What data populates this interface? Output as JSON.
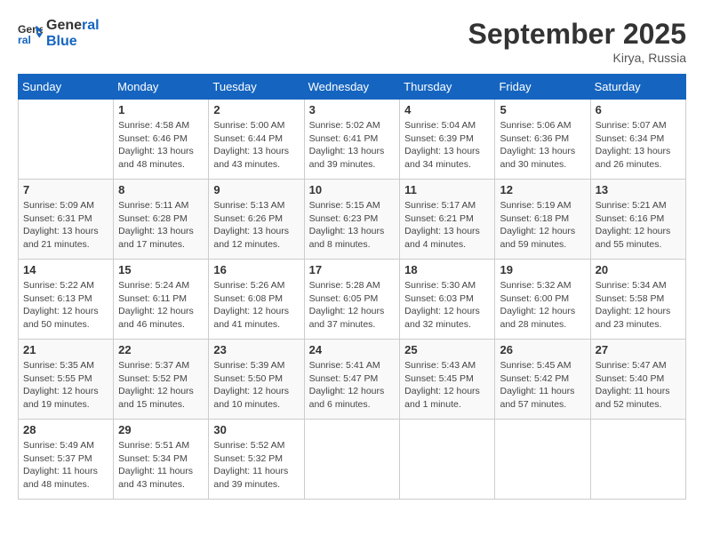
{
  "header": {
    "logo_line1": "General",
    "logo_line2": "Blue",
    "month": "September 2025",
    "location": "Kirya, Russia"
  },
  "days_of_week": [
    "Sunday",
    "Monday",
    "Tuesday",
    "Wednesday",
    "Thursday",
    "Friday",
    "Saturday"
  ],
  "weeks": [
    [
      {
        "day": "",
        "info": ""
      },
      {
        "day": "1",
        "info": "Sunrise: 4:58 AM\nSunset: 6:46 PM\nDaylight: 13 hours\nand 48 minutes."
      },
      {
        "day": "2",
        "info": "Sunrise: 5:00 AM\nSunset: 6:44 PM\nDaylight: 13 hours\nand 43 minutes."
      },
      {
        "day": "3",
        "info": "Sunrise: 5:02 AM\nSunset: 6:41 PM\nDaylight: 13 hours\nand 39 minutes."
      },
      {
        "day": "4",
        "info": "Sunrise: 5:04 AM\nSunset: 6:39 PM\nDaylight: 13 hours\nand 34 minutes."
      },
      {
        "day": "5",
        "info": "Sunrise: 5:06 AM\nSunset: 6:36 PM\nDaylight: 13 hours\nand 30 minutes."
      },
      {
        "day": "6",
        "info": "Sunrise: 5:07 AM\nSunset: 6:34 PM\nDaylight: 13 hours\nand 26 minutes."
      }
    ],
    [
      {
        "day": "7",
        "info": "Sunrise: 5:09 AM\nSunset: 6:31 PM\nDaylight: 13 hours\nand 21 minutes."
      },
      {
        "day": "8",
        "info": "Sunrise: 5:11 AM\nSunset: 6:28 PM\nDaylight: 13 hours\nand 17 minutes."
      },
      {
        "day": "9",
        "info": "Sunrise: 5:13 AM\nSunset: 6:26 PM\nDaylight: 13 hours\nand 12 minutes."
      },
      {
        "day": "10",
        "info": "Sunrise: 5:15 AM\nSunset: 6:23 PM\nDaylight: 13 hours\nand 8 minutes."
      },
      {
        "day": "11",
        "info": "Sunrise: 5:17 AM\nSunset: 6:21 PM\nDaylight: 13 hours\nand 4 minutes."
      },
      {
        "day": "12",
        "info": "Sunrise: 5:19 AM\nSunset: 6:18 PM\nDaylight: 12 hours\nand 59 minutes."
      },
      {
        "day": "13",
        "info": "Sunrise: 5:21 AM\nSunset: 6:16 PM\nDaylight: 12 hours\nand 55 minutes."
      }
    ],
    [
      {
        "day": "14",
        "info": "Sunrise: 5:22 AM\nSunset: 6:13 PM\nDaylight: 12 hours\nand 50 minutes."
      },
      {
        "day": "15",
        "info": "Sunrise: 5:24 AM\nSunset: 6:11 PM\nDaylight: 12 hours\nand 46 minutes."
      },
      {
        "day": "16",
        "info": "Sunrise: 5:26 AM\nSunset: 6:08 PM\nDaylight: 12 hours\nand 41 minutes."
      },
      {
        "day": "17",
        "info": "Sunrise: 5:28 AM\nSunset: 6:05 PM\nDaylight: 12 hours\nand 37 minutes."
      },
      {
        "day": "18",
        "info": "Sunrise: 5:30 AM\nSunset: 6:03 PM\nDaylight: 12 hours\nand 32 minutes."
      },
      {
        "day": "19",
        "info": "Sunrise: 5:32 AM\nSunset: 6:00 PM\nDaylight: 12 hours\nand 28 minutes."
      },
      {
        "day": "20",
        "info": "Sunrise: 5:34 AM\nSunset: 5:58 PM\nDaylight: 12 hours\nand 23 minutes."
      }
    ],
    [
      {
        "day": "21",
        "info": "Sunrise: 5:35 AM\nSunset: 5:55 PM\nDaylight: 12 hours\nand 19 minutes."
      },
      {
        "day": "22",
        "info": "Sunrise: 5:37 AM\nSunset: 5:52 PM\nDaylight: 12 hours\nand 15 minutes."
      },
      {
        "day": "23",
        "info": "Sunrise: 5:39 AM\nSunset: 5:50 PM\nDaylight: 12 hours\nand 10 minutes."
      },
      {
        "day": "24",
        "info": "Sunrise: 5:41 AM\nSunset: 5:47 PM\nDaylight: 12 hours\nand 6 minutes."
      },
      {
        "day": "25",
        "info": "Sunrise: 5:43 AM\nSunset: 5:45 PM\nDaylight: 12 hours\nand 1 minute."
      },
      {
        "day": "26",
        "info": "Sunrise: 5:45 AM\nSunset: 5:42 PM\nDaylight: 11 hours\nand 57 minutes."
      },
      {
        "day": "27",
        "info": "Sunrise: 5:47 AM\nSunset: 5:40 PM\nDaylight: 11 hours\nand 52 minutes."
      }
    ],
    [
      {
        "day": "28",
        "info": "Sunrise: 5:49 AM\nSunset: 5:37 PM\nDaylight: 11 hours\nand 48 minutes."
      },
      {
        "day": "29",
        "info": "Sunrise: 5:51 AM\nSunset: 5:34 PM\nDaylight: 11 hours\nand 43 minutes."
      },
      {
        "day": "30",
        "info": "Sunrise: 5:52 AM\nSunset: 5:32 PM\nDaylight: 11 hours\nand 39 minutes."
      },
      {
        "day": "",
        "info": ""
      },
      {
        "day": "",
        "info": ""
      },
      {
        "day": "",
        "info": ""
      },
      {
        "day": "",
        "info": ""
      }
    ]
  ]
}
